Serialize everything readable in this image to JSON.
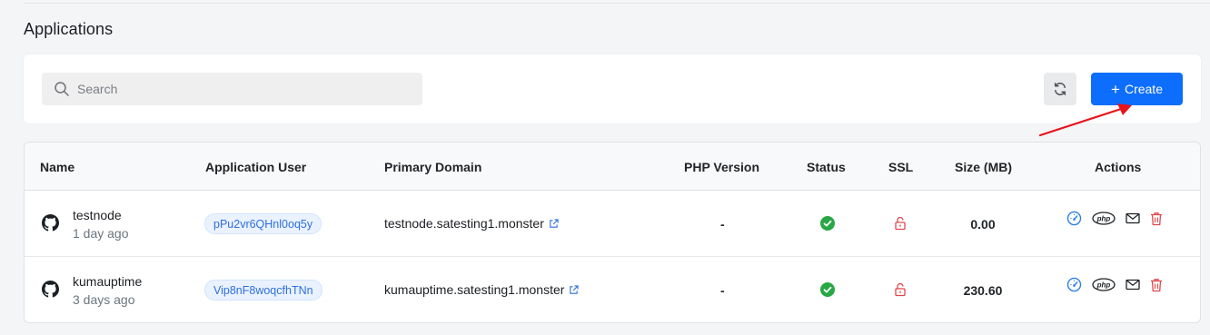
{
  "page": {
    "title": "Applications"
  },
  "toolbar": {
    "search_placeholder": "Search",
    "create_label": "Create"
  },
  "table": {
    "headers": {
      "name": "Name",
      "user": "Application User",
      "domain": "Primary Domain",
      "php": "PHP Version",
      "status": "Status",
      "ssl": "SSL",
      "size": "Size (MB)",
      "actions": "Actions"
    },
    "rows": [
      {
        "name": "testnode",
        "created": "1 day ago",
        "user": "pPu2vr6QHnl0oq5y",
        "domain": "testnode.satesting1.monster",
        "php": "-",
        "status": "active",
        "ssl": "not-secured",
        "size": "0.00"
      },
      {
        "name": "kumauptime",
        "created": "3 days ago",
        "user": "Vip8nF8woqcfhTNn",
        "domain": "kumauptime.satesting1.monster",
        "php": "-",
        "status": "active",
        "ssl": "not-secured",
        "size": "230.60"
      }
    ]
  },
  "colors": {
    "accent": "#0d6efd",
    "success": "#28a745",
    "danger": "#e0474c",
    "annotation": "#e8141b"
  },
  "icons": [
    "search-icon",
    "refresh-icon",
    "plus-icon",
    "github-icon",
    "external-link-icon",
    "check-circle-icon",
    "unlock-icon",
    "gauge-icon",
    "php-icon",
    "mail-icon",
    "trash-icon"
  ]
}
